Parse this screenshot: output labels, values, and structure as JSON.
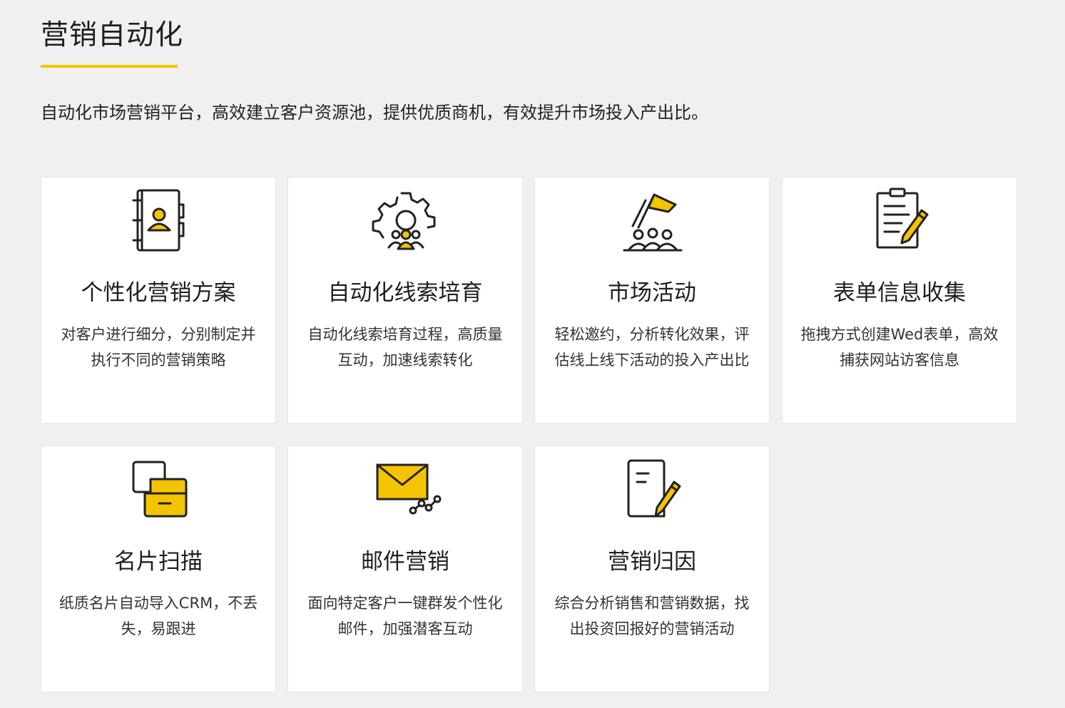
{
  "section": {
    "title": "营销自动化",
    "intro": "自动化市场营销平台，高效建立客户资源池，提供优质商机，有效提升市场投入产出比。",
    "accent_color": "#f5c400"
  },
  "cards": [
    {
      "icon": "contact-book-icon",
      "title": "个性化营销方案",
      "desc": "对客户进行细分，分别制定并执行不同的营销策略"
    },
    {
      "icon": "gear-people-icon",
      "title": "自动化线索培育",
      "desc": "自动化线索培育过程，高质量互动，加速线索转化"
    },
    {
      "icon": "flag-crowd-icon",
      "title": "市场活动",
      "desc": "轻松邀约，分析转化效果，评估线上线下活动的投入产出比"
    },
    {
      "icon": "clipboard-pencil-icon",
      "title": "表单信息收集",
      "desc": "拖拽方式创建Wed表单，高效捕获网站访客信息"
    },
    {
      "icon": "card-scan-icon",
      "title": "名片扫描",
      "desc": "纸质名片自动导入CRM，不丢失，易跟进"
    },
    {
      "icon": "envelope-chart-icon",
      "title": "邮件营销",
      "desc": "面向特定客户一键群发个性化邮件，加强潜客互动"
    },
    {
      "icon": "document-pencil-icon",
      "title": "营销归因",
      "desc": "综合分析销售和营销数据，找出投资回报好的营销活动"
    }
  ]
}
